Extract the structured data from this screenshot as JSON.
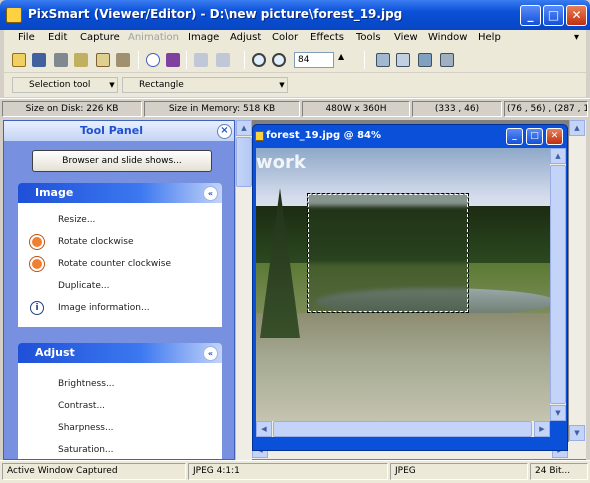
{
  "window": {
    "title": "PixSmart (Viewer/Editor) - D:\\new picture\\forest_19.jpg",
    "minimize": "_",
    "maximize": "□",
    "close": "✕"
  },
  "menu": [
    "File",
    "Edit",
    "Capture",
    "Animation",
    "Image",
    "Adjust",
    "Color",
    "Effects",
    "Tools",
    "View",
    "Window",
    "Help"
  ],
  "menu_overflow": "▾",
  "toolbar": {
    "zoom_value": "84",
    "tool_select": "Selection tool",
    "shape_select": "Rectangle"
  },
  "info": {
    "size_on_disk": "Size on Disk: 226 KB",
    "size_in_memory": "Size in Memory: 518 KB",
    "dimensions": "480W x 360H",
    "cursor": "(333 , 46)",
    "selection": "(76 , 56) , (287 , 1"
  },
  "tool_panel": {
    "title": "Tool Panel",
    "close": "×",
    "browser_button": "Browser and slide shows...",
    "groups": [
      {
        "title": "Image",
        "toggle": "«",
        "items": [
          {
            "label": "Resize...",
            "icon": ""
          },
          {
            "label": "Rotate clockwise",
            "icon": "rotate-cw-icon"
          },
          {
            "label": "Rotate counter clockwise",
            "icon": "rotate-ccw-icon"
          },
          {
            "label": "Duplicate...",
            "icon": ""
          },
          {
            "label": "Image information...",
            "icon": "info-icon"
          }
        ]
      },
      {
        "title": "Adjust",
        "toggle": "«",
        "items": [
          {
            "label": "Brightness...",
            "icon": ""
          },
          {
            "label": "Contrast...",
            "icon": ""
          },
          {
            "label": "Sharpness...",
            "icon": ""
          },
          {
            "label": "Saturation...",
            "icon": ""
          }
        ]
      }
    ]
  },
  "child_window": {
    "title": "forest_19.jpg @ 84%",
    "watermark": "work"
  },
  "status": {
    "message": "Active Window Captured",
    "compression": "JPEG 4:1:1",
    "format": "JPEG",
    "bits": "24 Bit..."
  },
  "colors": {
    "title_blue": "#0a50d8",
    "panel_blue": "#7890e0",
    "close_red": "#c03010"
  }
}
